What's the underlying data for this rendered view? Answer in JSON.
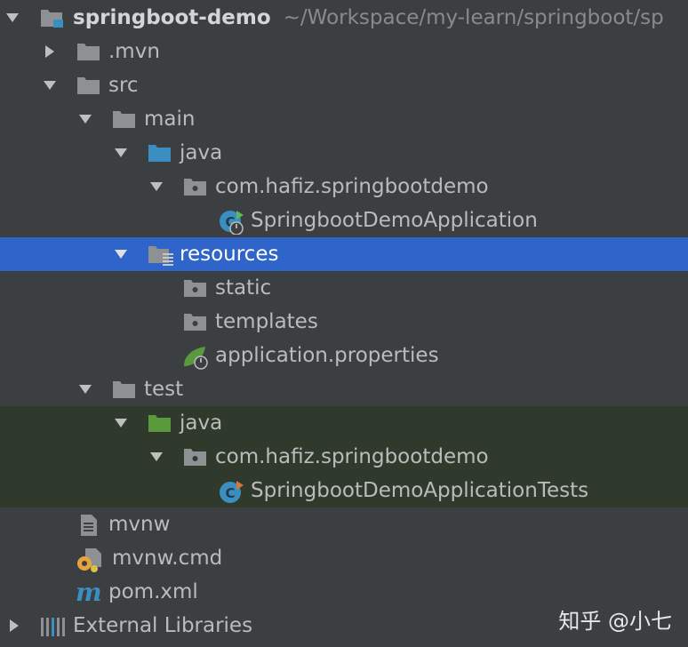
{
  "project_tree": {
    "root": {
      "name": "springboot-demo",
      "path": "~/Workspace/my-learn/springboot/sp"
    },
    "items": [
      {
        "label": ".mvn",
        "icon": "folder-icon",
        "expanded": false
      },
      {
        "label": "src",
        "icon": "folder-icon",
        "expanded": true
      },
      {
        "label": "main",
        "icon": "folder-icon",
        "expanded": true
      },
      {
        "label": "java",
        "icon": "source-folder-icon",
        "expanded": true
      },
      {
        "label": "com.hafiz.springbootdemo",
        "icon": "package-icon",
        "expanded": true
      },
      {
        "label": "SpringbootDemoApplication",
        "icon": "spring-boot-class-icon"
      },
      {
        "label": "resources",
        "icon": "resources-folder-icon",
        "expanded": true,
        "selected": true
      },
      {
        "label": "static",
        "icon": "package-icon"
      },
      {
        "label": "templates",
        "icon": "package-icon"
      },
      {
        "label": "application.properties",
        "icon": "spring-properties-icon"
      },
      {
        "label": "test",
        "icon": "folder-icon",
        "expanded": true
      },
      {
        "label": "java",
        "icon": "test-source-folder-icon",
        "expanded": true
      },
      {
        "label": "com.hafiz.springbootdemo",
        "icon": "package-icon",
        "expanded": true
      },
      {
        "label": "SpringbootDemoApplicationTests",
        "icon": "class-icon"
      },
      {
        "label": "mvnw",
        "icon": "text-file-icon"
      },
      {
        "label": "mvnw.cmd",
        "icon": "script-file-icon"
      },
      {
        "label": "pom.xml",
        "icon": "maven-icon"
      },
      {
        "label": "External Libraries",
        "icon": "libraries-icon",
        "expanded": false
      }
    ]
  },
  "watermark": "知乎 @小七",
  "colors": {
    "background": "#3c3f41",
    "selection": "#2f65ca",
    "test_highlight": "#2f3a2d",
    "text": "#bbbbbb",
    "folder": "#8d9194",
    "source_folder": "#3b8fc0",
    "test_folder": "#5b9a3c"
  }
}
